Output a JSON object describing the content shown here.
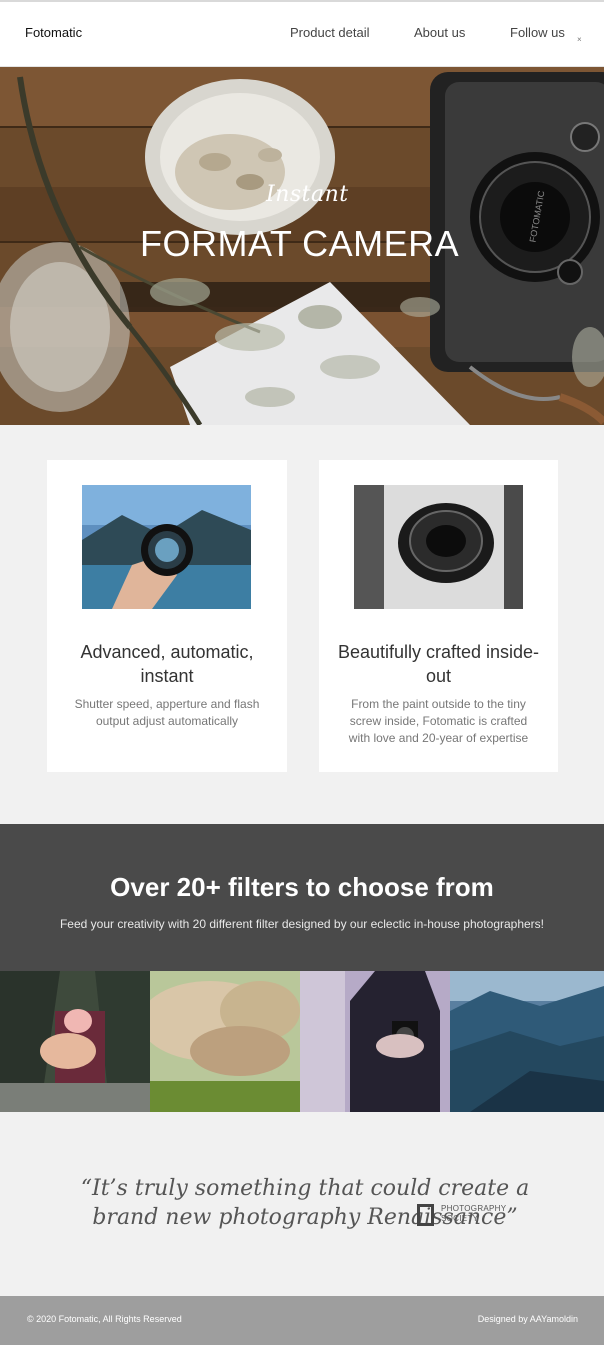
{
  "nav": {
    "brand": "Fotomatic",
    "links": [
      "Product detail",
      "About us",
      "Follow us"
    ],
    "dot": "×"
  },
  "hero": {
    "subtitle": "Instant",
    "title": "FORMAT CAMERA",
    "camera_brand": "FOTOMATIC"
  },
  "features": [
    {
      "title": "Advanced, automatic, instant",
      "text": "Shutter speed, apperture and flash output adjust automatically"
    },
    {
      "title": "Beautifully crafted inside-out",
      "text": "From the paint outside to the tiny screw inside, Fotomatic is crafted with love and 20-year of expertise"
    }
  ],
  "filters": {
    "heading": "Over 20+ filters to choose from",
    "subheading": "Feed your creativity with 20 different filter designed by our eclectic in-house photographers!"
  },
  "quote": {
    "text": "“It’s truly something that could create a brand new photography Renaissance”",
    "source_line1": "PHOTOGRAPHY",
    "source_line2": "SOCIETY"
  },
  "footer": {
    "copyright": "© 2020 Fotomatic, All Rights Reserved",
    "credit": "Designed by AAYamoldin"
  },
  "colors": {
    "band": "#4a4a4a",
    "section_bg": "#f1f1f1",
    "footer_bg": "#9e9e9e"
  }
}
